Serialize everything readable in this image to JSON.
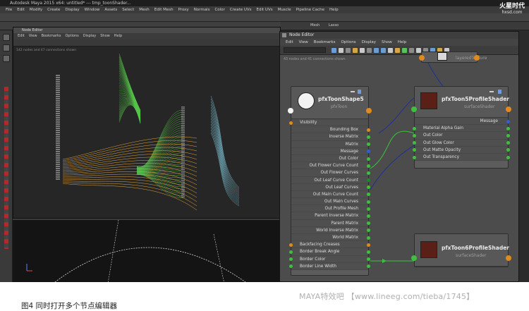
{
  "maya": {
    "title": "Autodesk Maya 2015 x64: untitled*  ---  tmp_toonShader...",
    "menus": [
      "File",
      "Edit",
      "Modify",
      "Create",
      "Display",
      "Window",
      "Assets",
      "Select",
      "Mesh",
      "Edit Mesh",
      "Proxy",
      "Normals",
      "Color",
      "Create UVs",
      "Edit UVs",
      "Muscle",
      "Pipeline Cache",
      "Help"
    ]
  },
  "node_editor_back": {
    "title": "Node Editor",
    "menus": [
      "Edit",
      "View",
      "Bookmarks",
      "Options",
      "Display",
      "Show",
      "Help"
    ],
    "info": "142 nodes and 47 connections shown"
  },
  "right_dock": {
    "tabs": [
      "Mesh",
      "Lasso"
    ]
  },
  "node_editor_front": {
    "title": "Node Editor",
    "menus": [
      "Edit",
      "View",
      "Bookmarks",
      "Options",
      "Display",
      "Show",
      "Help"
    ],
    "info": "43 nodes and 41 connections shown",
    "nodes": {
      "toon_shape": {
        "title": "pfxToonShape5",
        "type": "pfxToon",
        "attributes": [
          "Visibility",
          "Bounding Box",
          "Inverse Matrix",
          "Matrix",
          "Message",
          "Out Color",
          "Out Flower Curve Count",
          "Out Flower Curves",
          "Out Leaf Curve Count",
          "Out Leaf Curves",
          "Out Main Curve Count",
          "Out Main Curves",
          "Out Profile Mesh",
          "Parent Inverse Matrix",
          "Parent Matrix",
          "World Inverse Matrix",
          "World Matrix",
          "Backfacing Creases",
          "Border Break Angle",
          "Border Color",
          "Border Line Width"
        ]
      },
      "profile5": {
        "title": "pfxToon5ProfileShader",
        "type": "surfaceShader",
        "attributes": [
          "Message",
          "Material Alpha Gain",
          "Out Color",
          "Out Glow Color",
          "Out Matte Opacity",
          "Out Transparency"
        ]
      },
      "profile6": {
        "title": "pfxToon6ProfileShader",
        "type": "surfaceShader"
      },
      "top_node": {
        "title": "layeredTexture"
      }
    }
  },
  "caption": {
    "left": "图4 同时打开多个节点编辑器",
    "right": "MAYA特效吧 【www.lineeg.com/tieba/1745】"
  },
  "logo": {
    "line1": "火星时代",
    "line2": "hxsd.com"
  },
  "colors": {
    "port_green": "#3fbf3f",
    "port_orange": "#e08a1e",
    "port_blue": "#2f5fd6",
    "curve_green": "#57c94a",
    "curve_orange": "#e6a63a",
    "curve_cyan": "#7fc6d9"
  }
}
